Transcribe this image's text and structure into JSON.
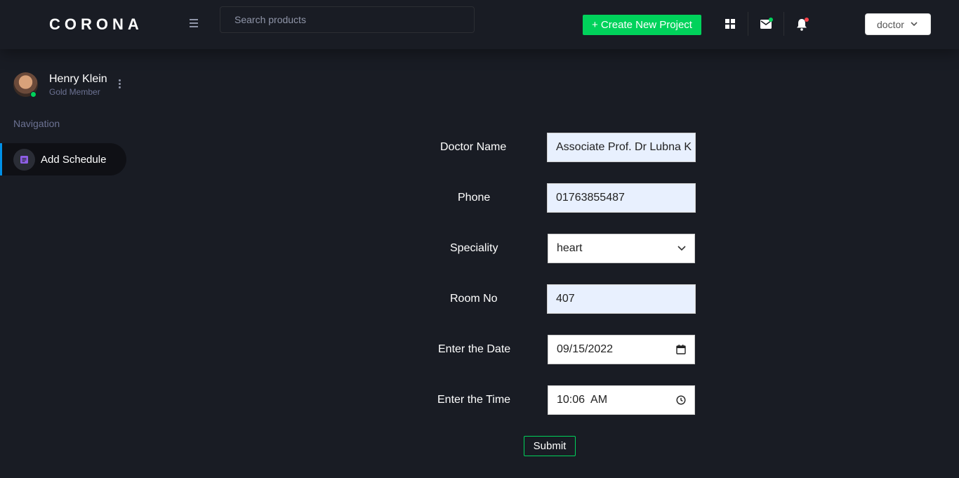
{
  "brand": "CORONA",
  "search": {
    "placeholder": "Search products"
  },
  "header": {
    "create_label": "+ Create New Project",
    "profile_label": "doctor",
    "mail_dot_color": "#00d25b",
    "bell_dot_color": "#fc424a"
  },
  "sidebar": {
    "user_name": "Henry Klein",
    "user_role": "Gold Member",
    "nav_heading": "Navigation",
    "items": [
      {
        "label": "Add Schedule",
        "icon": "schedule-icon"
      }
    ]
  },
  "form": {
    "doctor_name_label": "Doctor Name",
    "doctor_name_value": "Associate Prof. Dr Lubna K",
    "phone_label": "Phone",
    "phone_value": "01763855487",
    "speciality_label": "Speciality",
    "speciality_value": "heart",
    "room_label": "Room No",
    "room_value": "407",
    "date_label": "Enter the Date",
    "date_value": "09/15/2022",
    "time_label": "Enter the Time",
    "time_value": "10:06  AM",
    "submit_label": "Submit"
  },
  "colors": {
    "accent_green": "#00d25b",
    "accent_blue": "#0090e7",
    "background": "#191c24"
  }
}
